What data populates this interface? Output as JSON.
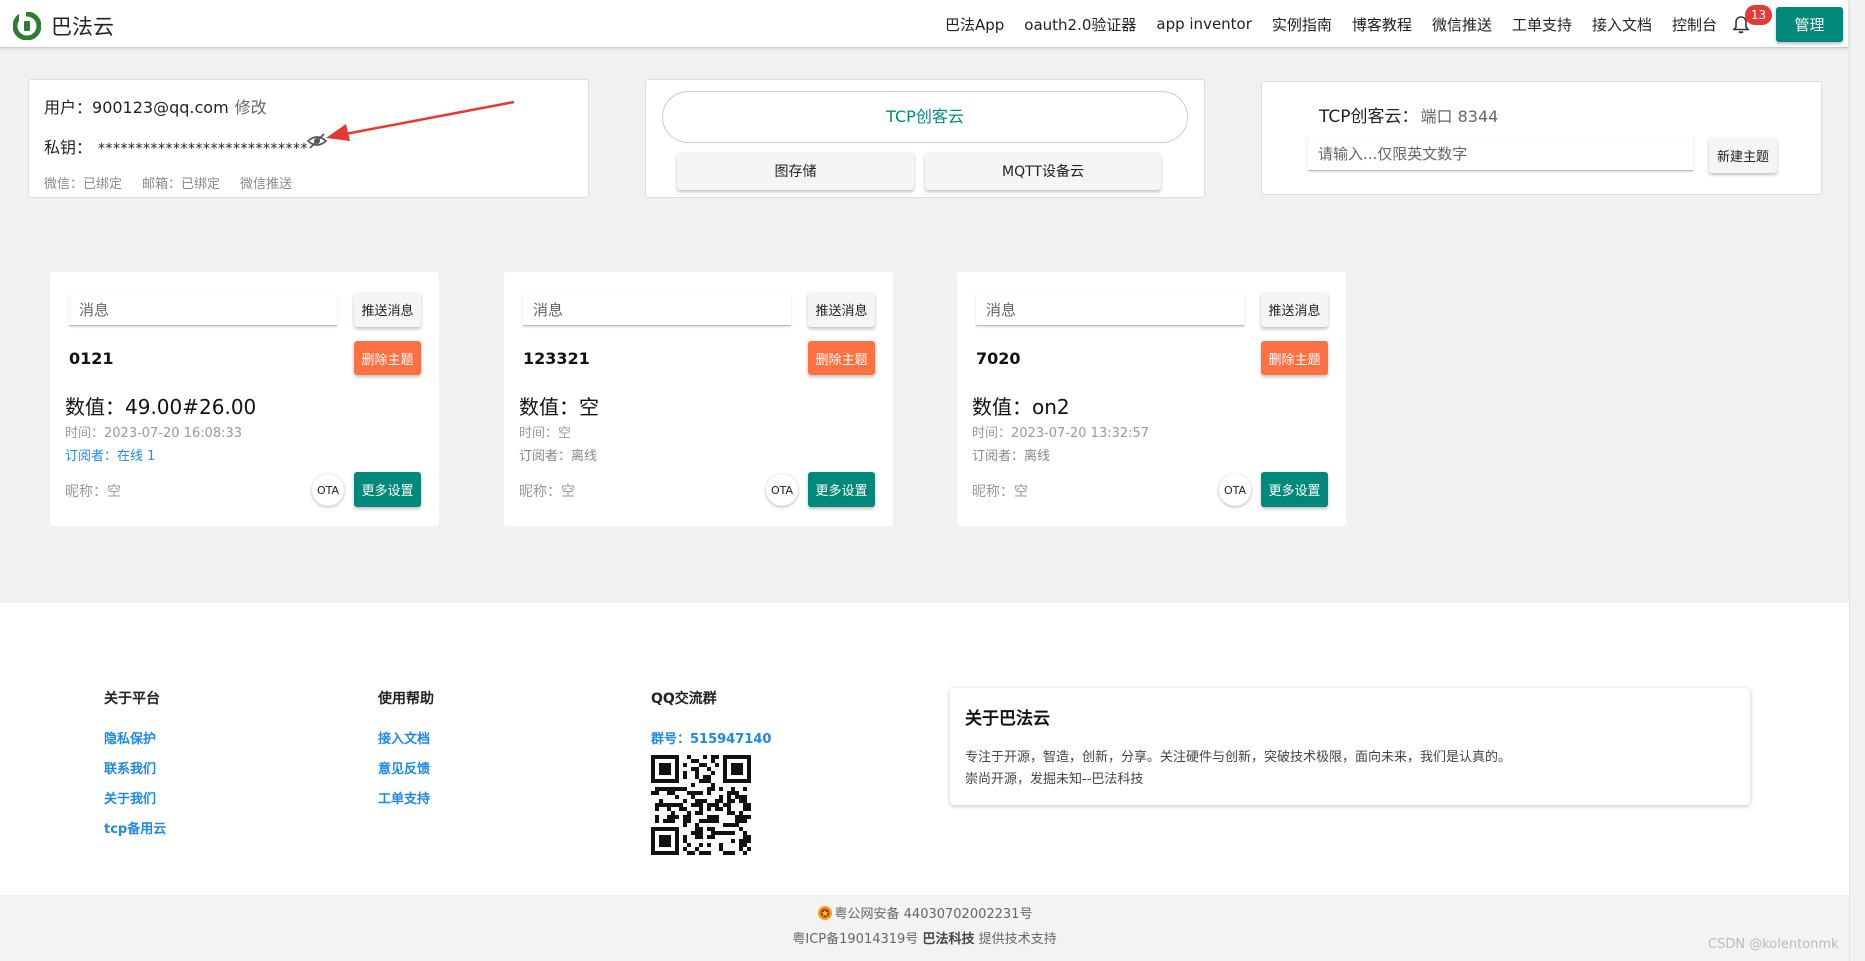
{
  "brand": {
    "name": "巴法云"
  },
  "nav": {
    "items": [
      "巴法App",
      "oauth2.0验证器",
      "app inventor",
      "实例指南",
      "博客教程",
      "微信推送",
      "工单支持",
      "接入文档",
      "控制台"
    ],
    "notification_count": "13",
    "manage_label": "管理"
  },
  "account": {
    "user_label": "用户：",
    "email": "900123@qq.com",
    "edit_label": "修改",
    "key_label": "私钥：",
    "key_masked": "****************************",
    "wechat_status": "微信：已绑定",
    "email_status": "邮箱：已绑定",
    "wechat_push": "微信推送"
  },
  "cloud": {
    "tcp_label": "TCP创客云",
    "image_store_label": "图存储",
    "mqtt_label": "MQTT设备云"
  },
  "create": {
    "title": "TCP创客云：",
    "port": "端口 8344",
    "placeholder": "请输入...仅限英文数字",
    "button": "新建主题"
  },
  "cards": [
    {
      "msg_placeholder": "消息",
      "push_label": "推送消息",
      "topic": "0121",
      "delete_label": "删除主题",
      "value": "数值：49.00#26.00",
      "time": "时间：2023-07-20 16:08:33",
      "subscriber_label": "订阅者：",
      "subscriber": "在线 1",
      "nickname": "昵称：空",
      "ota_label": "OTA",
      "more_label": "更多设置"
    },
    {
      "msg_placeholder": "消息",
      "push_label": "推送消息",
      "topic": "123321",
      "delete_label": "删除主题",
      "value": "数值：空",
      "time": "时间：空",
      "subscriber_label": "订阅者：",
      "subscriber": "离线",
      "nickname": "昵称：空",
      "ota_label": "OTA",
      "more_label": "更多设置"
    },
    {
      "msg_placeholder": "消息",
      "push_label": "推送消息",
      "topic": "7020",
      "delete_label": "删除主题",
      "value": "数值：on2",
      "time": "时间：2023-07-20 13:32:57",
      "subscriber_label": "订阅者：",
      "subscriber": "离线",
      "nickname": "昵称：空",
      "ota_label": "OTA",
      "more_label": "更多设置"
    }
  ],
  "footer": {
    "platform": {
      "title": "关于平台",
      "links": [
        "隐私保护",
        "联系我们",
        "关于我们",
        "tcp备用云"
      ]
    },
    "help": {
      "title": "使用帮助",
      "links": [
        "接入文档",
        "意见反馈",
        "工单支持"
      ]
    },
    "qq": {
      "title": "QQ交流群",
      "group": "群号：515947140"
    },
    "about": {
      "title": "关于巴法云",
      "line1": "专注于开源，智造，创新，分享。关注硬件与创新，突破技术极限，面向未来，我们是认真的。",
      "line2": "崇尚开源，发掘未知--巴法科技"
    },
    "police_beian": "粤公网安备 44030702002231号",
    "icp": "粤ICP备19014319号",
    "company": "巴法科技",
    "support": "提供技术支持"
  },
  "watermark": "CSDN @kolentonmk",
  "colors": {
    "accent": "#00897b",
    "danger": "#ff7043",
    "link": "#1e88e5",
    "badge": "#e53935"
  }
}
